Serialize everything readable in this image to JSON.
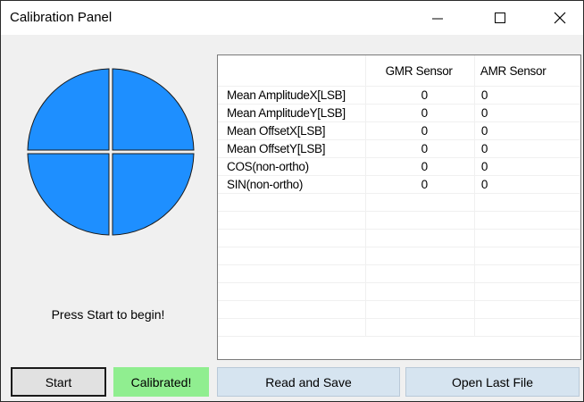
{
  "window": {
    "title": "Calibration Panel",
    "controls": {
      "minimize_icon": "minimize-icon",
      "maximize_icon": "maximize-icon",
      "close_icon": "close-icon"
    }
  },
  "graphic": {
    "name": "quadrant-circle",
    "fill_color": "#1e8fff"
  },
  "status": {
    "message": "Press Start to begin!"
  },
  "grid": {
    "columns": [
      "",
      "GMR Sensor",
      "AMR Sensor"
    ],
    "rows": [
      {
        "label": "Mean AmplitudeX[LSB]",
        "gmr": "0",
        "amr": "0"
      },
      {
        "label": "Mean AmplitudeY[LSB]",
        "gmr": "0",
        "amr": "0"
      },
      {
        "label": "Mean OffsetX[LSB]",
        "gmr": "0",
        "amr": "0"
      },
      {
        "label": "Mean OffsetY[LSB]",
        "gmr": "0",
        "amr": "0"
      },
      {
        "label": "COS(non-ortho)",
        "gmr": "0",
        "amr": "0"
      },
      {
        "label": "SIN(non-ortho)",
        "gmr": "0",
        "amr": "0"
      }
    ]
  },
  "buttons": {
    "start": "Start",
    "calibrated": "Calibrated!",
    "read_save": "Read and Save",
    "open_last": "Open Last File"
  },
  "colors": {
    "calibrated_bg": "#90ee90",
    "action_button_bg": "#d6e4f0",
    "graphic_blue": "#1e8fff"
  }
}
